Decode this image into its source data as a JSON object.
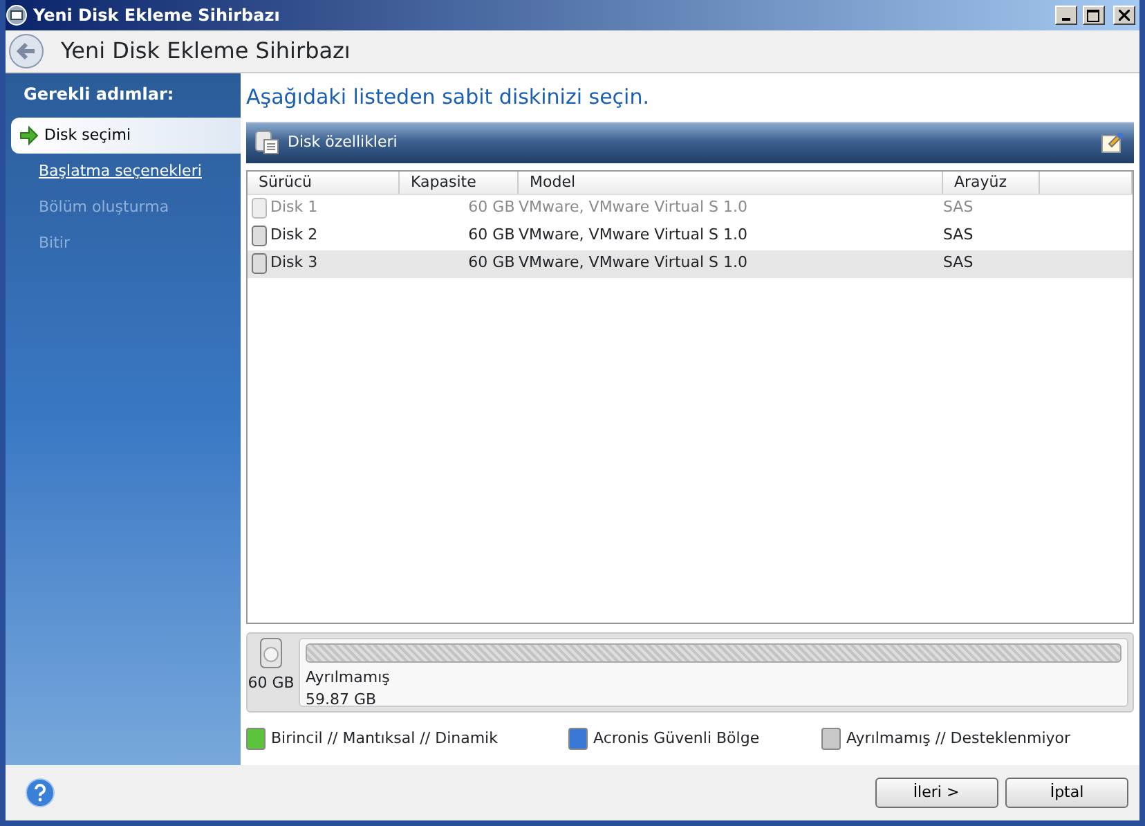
{
  "window": {
    "title": "Yeni Disk Ekleme Sihirbazı"
  },
  "header": {
    "title": "Yeni Disk Ekleme Sihirbazı"
  },
  "sidebar": {
    "heading": "Gerekli adımlar:",
    "steps": [
      {
        "label": "Disk seçimi",
        "selected": true,
        "disabled": false
      },
      {
        "label": "Başlatma seçenekleri",
        "selected": false,
        "disabled": false
      },
      {
        "label": "Bölüm oluşturma",
        "selected": false,
        "disabled": true
      },
      {
        "label": "Bitir",
        "selected": false,
        "disabled": true
      }
    ]
  },
  "instruction": "Aşağıdaki listeden sabit diskinizi seçin.",
  "toolbar": {
    "label": "Disk özellikleri"
  },
  "table": {
    "columns": [
      "Sürücü",
      "Kapasite",
      "Model",
      "Arayüz"
    ],
    "rows": [
      {
        "cells": [
          "Disk 1",
          "60 GB",
          "VMware, VMware Virtual S 1.0",
          "SAS"
        ],
        "selected": false,
        "disabled": true
      },
      {
        "cells": [
          "Disk 2",
          "60 GB",
          "VMware, VMware Virtual S 1.0",
          "SAS"
        ],
        "selected": false,
        "disabled": false
      },
      {
        "cells": [
          "Disk 3",
          "60 GB",
          "VMware, VMware Virtual S 1.0",
          "SAS"
        ],
        "selected": true,
        "disabled": false
      }
    ]
  },
  "disk_map": {
    "size": "60 GB",
    "partition": {
      "label": "Ayrılmamış",
      "size": "59.87 GB"
    }
  },
  "legend": [
    {
      "label": "Birincil // Mantıksal // Dinamik",
      "color": "#5cc43c"
    },
    {
      "label": "Acronis Güvenli Bölge",
      "color": "#3a78d8"
    },
    {
      "label": "Ayrılmamış // Desteklenmiyor",
      "color": "#c8c8c8"
    }
  ],
  "buttons": [
    "İleri >",
    "İptal"
  ]
}
